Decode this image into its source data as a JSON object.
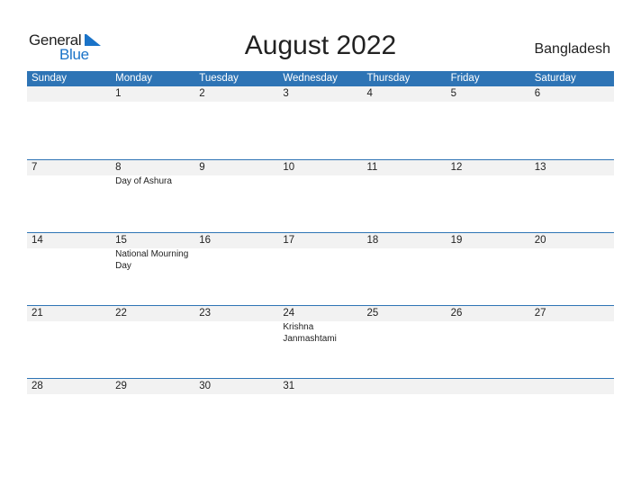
{
  "logo": {
    "general": "General",
    "blue": "Blue"
  },
  "title": "August 2022",
  "country": "Bangladesh",
  "colors": {
    "header_bg": "#2e74b5",
    "logo_blue": "#1a73c8",
    "day_row_bg": "#f2f2f2"
  },
  "weekdays": [
    "Sunday",
    "Monday",
    "Tuesday",
    "Wednesday",
    "Thursday",
    "Friday",
    "Saturday"
  ],
  "weeks": [
    {
      "days": [
        "",
        "1",
        "2",
        "3",
        "4",
        "5",
        "6"
      ],
      "events": [
        "",
        "",
        "",
        "",
        "",
        "",
        ""
      ]
    },
    {
      "days": [
        "7",
        "8",
        "9",
        "10",
        "11",
        "12",
        "13"
      ],
      "events": [
        "",
        "Day of Ashura",
        "",
        "",
        "",
        "",
        ""
      ]
    },
    {
      "days": [
        "14",
        "15",
        "16",
        "17",
        "18",
        "19",
        "20"
      ],
      "events": [
        "",
        "National Mourning Day",
        "",
        "",
        "",
        "",
        ""
      ]
    },
    {
      "days": [
        "21",
        "22",
        "23",
        "24",
        "25",
        "26",
        "27"
      ],
      "events": [
        "",
        "",
        "",
        "Krishna Janmashtami",
        "",
        "",
        ""
      ]
    },
    {
      "days": [
        "28",
        "29",
        "30",
        "31",
        "",
        "",
        ""
      ],
      "events": [
        "",
        "",
        "",
        "",
        "",
        "",
        ""
      ]
    }
  ]
}
